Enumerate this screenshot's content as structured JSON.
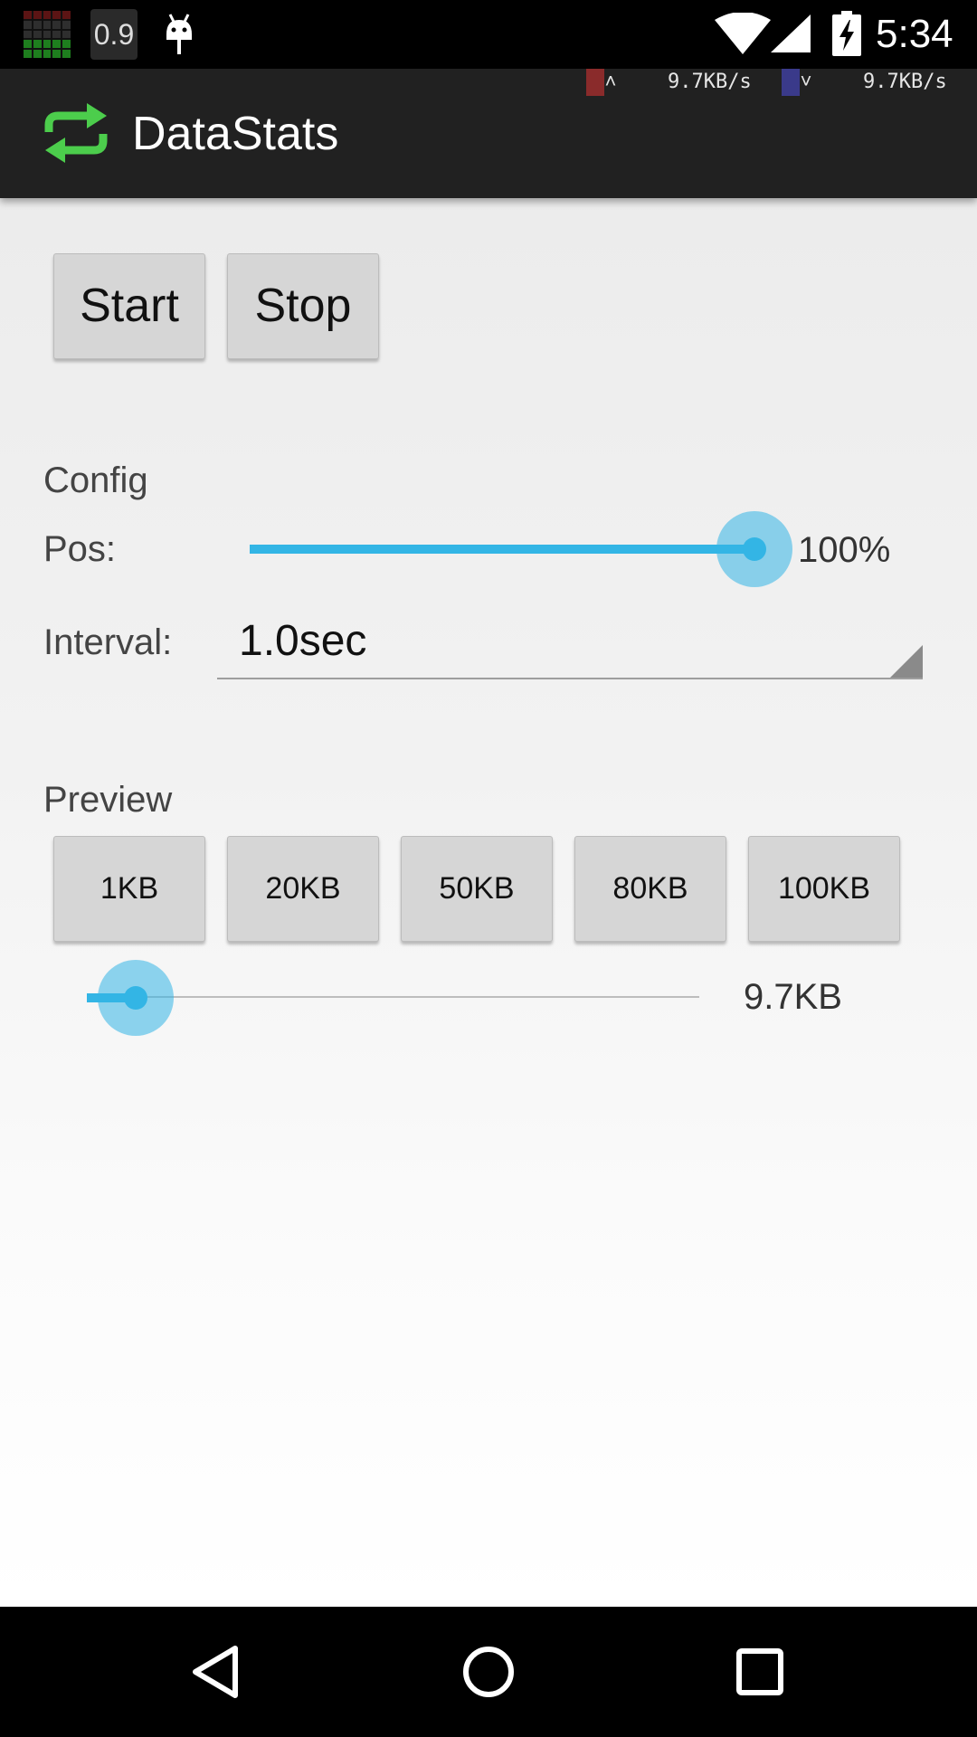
{
  "status_bar": {
    "cpu_value": "0.9",
    "time": "5:34",
    "icons": [
      "cpu-grid-icon",
      "android-debug-icon",
      "wifi-icon",
      "signal-icon",
      "battery-charging-icon"
    ]
  },
  "net_meter": {
    "upload_arrow": "^",
    "upload_speed": "9.7KB/s",
    "download_arrow": "v",
    "download_speed": "9.7KB/s",
    "upload_color": "#8a2b2b",
    "download_color": "#3a3a8a"
  },
  "app_bar": {
    "title": "DataStats",
    "logo_icon": "repeat-arrows-icon",
    "logo_color": "#4ccd4c"
  },
  "controls": {
    "start_label": "Start",
    "stop_label": "Stop"
  },
  "config": {
    "section_label": "Config",
    "pos_label": "Pos:",
    "pos_value_text": "100%",
    "pos_fraction": 1.0,
    "interval_label": "Interval:",
    "interval_value": "1.0sec"
  },
  "preview": {
    "section_label": "Preview",
    "buttons": [
      "1KB",
      "20KB",
      "50KB",
      "80KB",
      "100KB"
    ],
    "size_value_text": "9.7KB",
    "size_fraction": 0.08
  },
  "accent_color": "#33b5e5",
  "nav_bar": {
    "icons": [
      "back-icon",
      "home-icon",
      "recents-icon"
    ]
  }
}
